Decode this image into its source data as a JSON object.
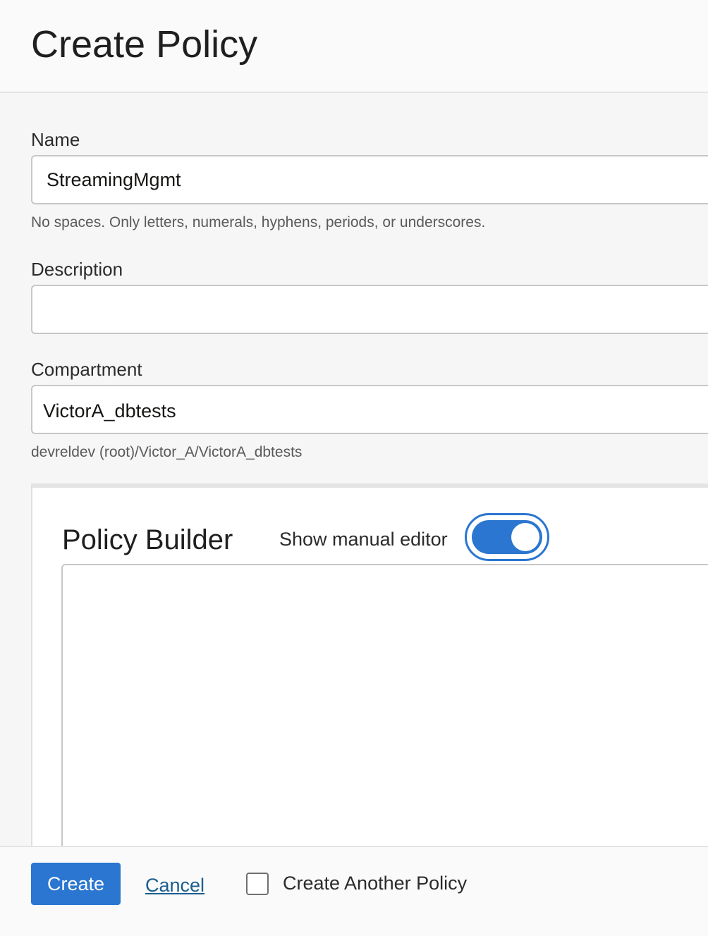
{
  "header": {
    "title": "Create Policy"
  },
  "form": {
    "name": {
      "label": "Name",
      "value": "StreamingMgmt",
      "hint": "No spaces. Only letters, numerals, hyphens, periods, or underscores."
    },
    "description": {
      "label": "Description",
      "value": ""
    },
    "compartment": {
      "label": "Compartment",
      "value": "VictorA_dbtests",
      "path": "devreldev (root)/Victor_A/VictorA_dbtests"
    }
  },
  "policy_builder": {
    "title": "Policy Builder",
    "toggle_label": "Show manual editor",
    "toggle_on": true,
    "editor_text": ""
  },
  "footer": {
    "create_label": "Create",
    "cancel_label": "Cancel",
    "create_another_label": "Create Another Policy",
    "create_another_checked": false
  },
  "colors": {
    "accent": "#2a76d0",
    "link": "#1b5d8f"
  }
}
